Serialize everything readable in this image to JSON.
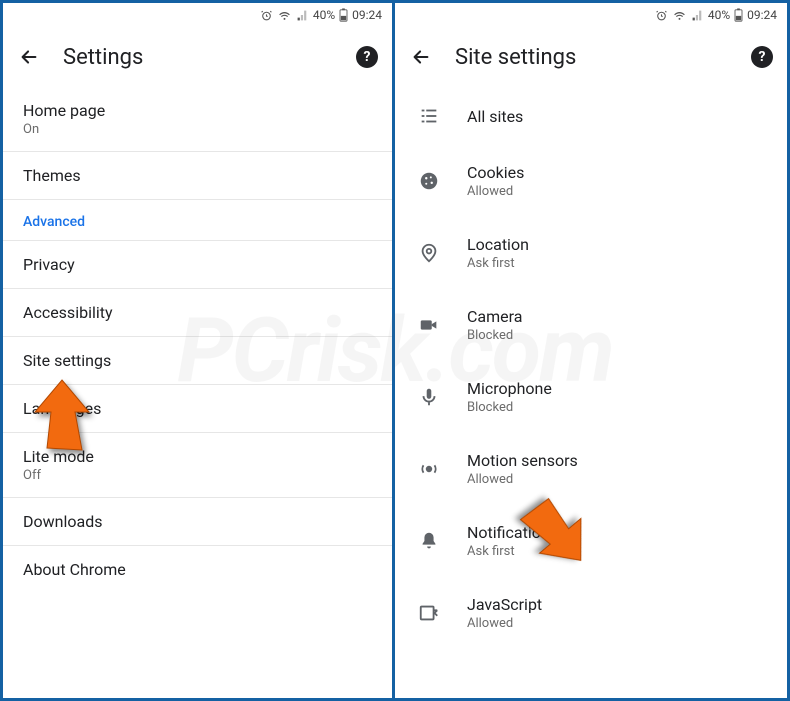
{
  "status": {
    "battery_pct": "40%",
    "time": "09:24"
  },
  "left": {
    "title": "Settings",
    "items": [
      {
        "label": "Home page",
        "sub": "On"
      },
      {
        "label": "Themes",
        "sub": null
      },
      {
        "section": "Advanced"
      },
      {
        "label": "Privacy",
        "sub": null
      },
      {
        "label": "Accessibility",
        "sub": null
      },
      {
        "label": "Site settings",
        "sub": null
      },
      {
        "label": "Languages",
        "sub": null
      },
      {
        "label": "Lite mode",
        "sub": "Off"
      },
      {
        "label": "Downloads",
        "sub": null
      },
      {
        "label": "About Chrome",
        "sub": null
      }
    ]
  },
  "right": {
    "title": "Site settings",
    "items": [
      {
        "icon": "list",
        "label": "All sites",
        "sub": null
      },
      {
        "icon": "cookie",
        "label": "Cookies",
        "sub": "Allowed"
      },
      {
        "icon": "location",
        "label": "Location",
        "sub": "Ask first"
      },
      {
        "icon": "camera",
        "label": "Camera",
        "sub": "Blocked"
      },
      {
        "icon": "microphone",
        "label": "Microphone",
        "sub": "Blocked"
      },
      {
        "icon": "motion",
        "label": "Motion sensors",
        "sub": "Allowed"
      },
      {
        "icon": "bell",
        "label": "Notifications",
        "sub": "Ask first"
      },
      {
        "icon": "javascript",
        "label": "JavaScript",
        "sub": "Allowed"
      }
    ]
  },
  "watermark": "PCrisk.com"
}
